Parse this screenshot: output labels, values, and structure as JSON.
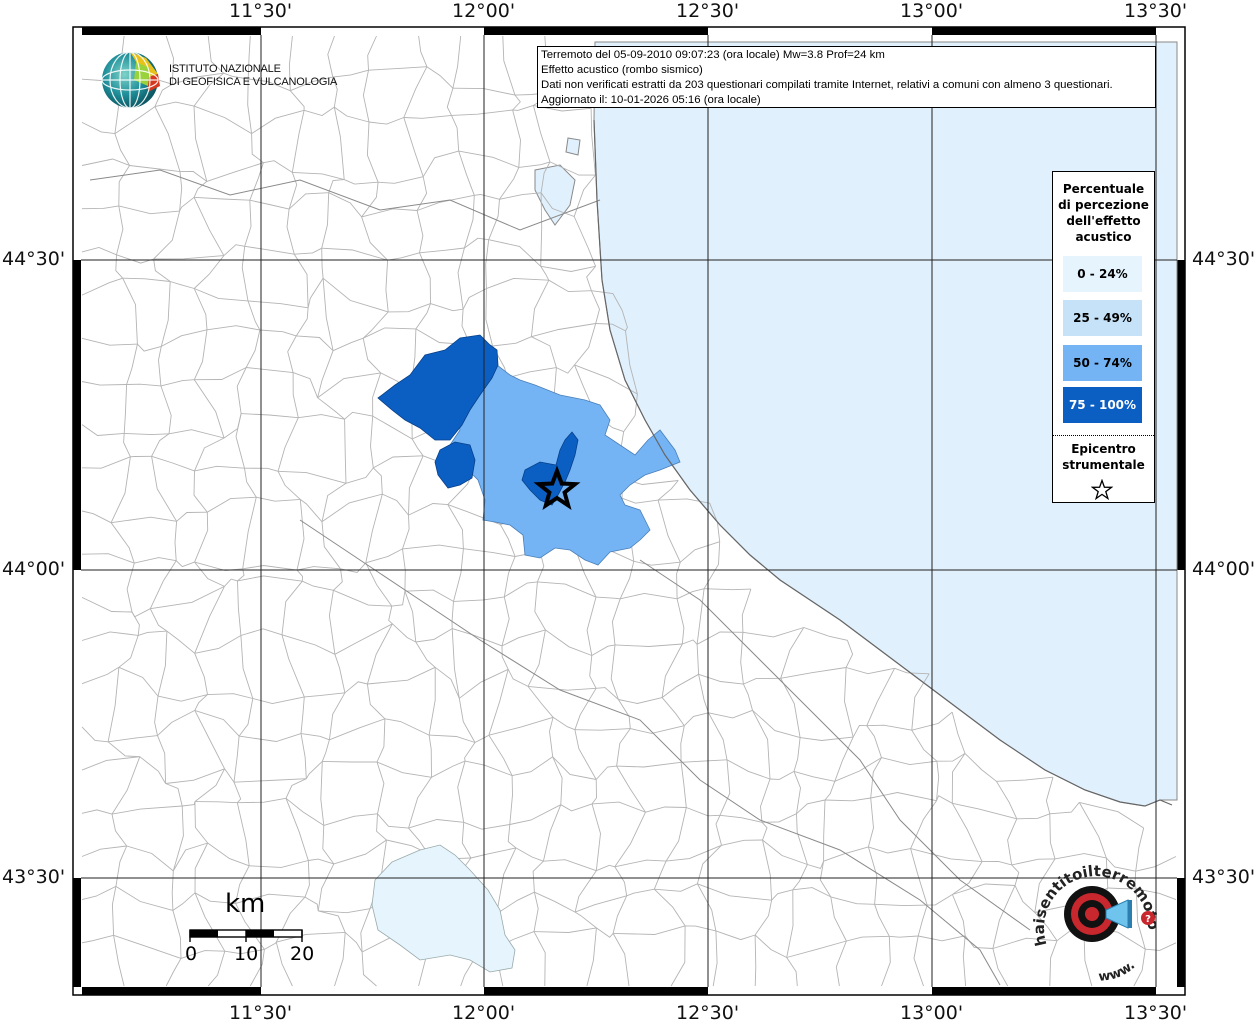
{
  "info": {
    "line1": "Terremoto del 05-09-2010 09:07:23 (ora locale) Mw=3.8 Prof=24 km",
    "line2": "Effetto acustico (rombo sismico)",
    "line3": "Dati non verificati estratti da 203 questionari compilati tramite Internet, relativi a comuni con almeno 3 questionari.",
    "line4": "Aggiornato il: 10-01-2026 05:16 (ora locale)"
  },
  "ingv": {
    "line1": "ISTITUTO NAZIONALE",
    "line2": "DI GEOFISICA E VULCANOLOGIA"
  },
  "axes": {
    "lon_labels": [
      "11°30'",
      "12°00'",
      "12°30'",
      "13°00'",
      "13°30'"
    ],
    "lat_labels": [
      "44°30'",
      "44°00'",
      "43°30'"
    ]
  },
  "legend": {
    "title_lines": [
      "Percentuale",
      "di percezione",
      "dell'effetto",
      "acustico"
    ],
    "classes": [
      {
        "label": "0 - 24%",
        "color": "#e6f4fd"
      },
      {
        "label": "25 - 49%",
        "color": "#c6e2f8"
      },
      {
        "label": "50 - 74%",
        "color": "#74b4f5"
      },
      {
        "label": "75 - 100%",
        "color": "#0c5fc2"
      }
    ],
    "epicenter_lines": [
      "Epicentro",
      "strumentale"
    ]
  },
  "scalebar": {
    "unit": "km",
    "ticks": [
      "0",
      "10",
      "20"
    ]
  },
  "logo_hsit": {
    "text": "haisentitoilterremoto.it",
    "prefix": "www."
  },
  "colors": {
    "sea": "#e0f0fc",
    "grid": "#222222",
    "border": "#b4b4b4",
    "epicenter": "#000000"
  }
}
